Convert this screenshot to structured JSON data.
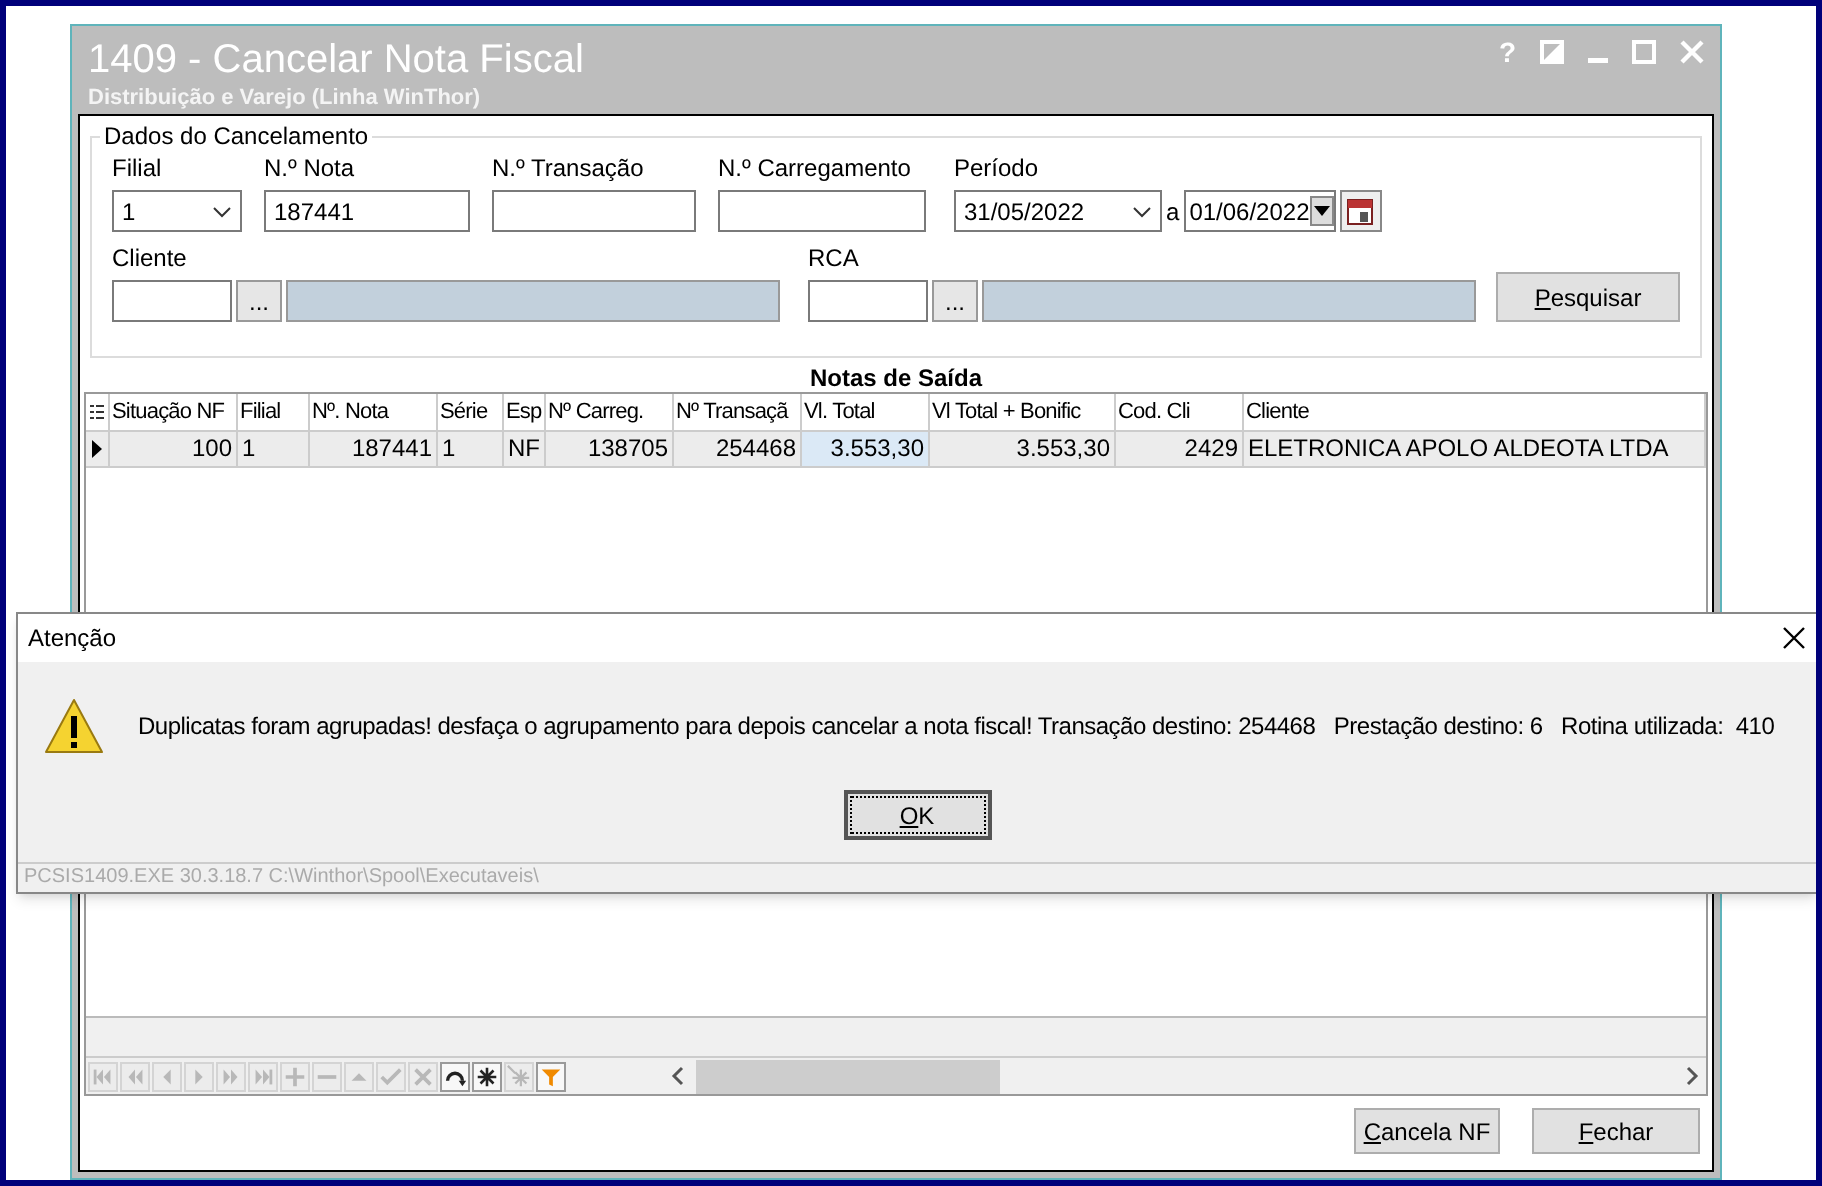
{
  "window": {
    "title": "1409 - Cancelar Nota Fiscal",
    "subtitle": "Distribuição e Varejo (Linha WinThor)",
    "controls": [
      "?"
    ]
  },
  "filter_group": {
    "title": "Dados do Cancelamento",
    "filial": {
      "label": "Filial",
      "value": "1"
    },
    "nota": {
      "label": "N.º Nota",
      "value": "187441"
    },
    "transacao": {
      "label": "N.º Transação"
    },
    "carregamento": {
      "label": "N.º Carregamento"
    },
    "periodo": {
      "label": "Período",
      "from": "31/05/2022",
      "separator": "a",
      "to": "01/06/2022"
    },
    "cliente": {
      "label": "Cliente",
      "lookup": "..."
    },
    "rca": {
      "label": "RCA",
      "lookup": "..."
    },
    "search_button": "Pesquisar"
  },
  "grid": {
    "title": "Notas de Saída",
    "columns": [
      {
        "label": "Situação NF",
        "kind": "number"
      },
      {
        "label": "Filial",
        "kind": "text"
      },
      {
        "label": "Nº. Nota",
        "kind": "number"
      },
      {
        "label": "Série",
        "kind": "text"
      },
      {
        "label": "Esp",
        "kind": "text"
      },
      {
        "label": "Nº Carreg.",
        "kind": "number"
      },
      {
        "label": "Nº Transaçã",
        "kind": "number"
      },
      {
        "label": "Vl. Total",
        "kind": "number"
      },
      {
        "label": "Vl Total + Bonific",
        "kind": "number"
      },
      {
        "label": "Cod. Cli",
        "kind": "number"
      },
      {
        "label": "Cliente",
        "kind": "text"
      }
    ],
    "rows": [
      {
        "selected": true,
        "cells": [
          {
            "text": "100",
            "focused": false
          },
          {
            "text": "1",
            "focused": false
          },
          {
            "text": "187441",
            "focused": false
          },
          {
            "text": "1",
            "focused": false
          },
          {
            "text": "NF",
            "focused": false
          },
          {
            "text": "138705",
            "focused": false
          },
          {
            "text": "254468",
            "focused": false
          },
          {
            "text": "3.553,30",
            "focused": true
          },
          {
            "text": "3.553,30",
            "focused": false
          },
          {
            "text": "2429",
            "focused": false
          },
          {
            "text": "ELETRONICA APOLO ALDEOTA LTDA",
            "focused": false
          }
        ]
      }
    ]
  },
  "navigator": [
    {
      "kind": "first",
      "disabled": true
    },
    {
      "kind": "prior-page",
      "disabled": true
    },
    {
      "kind": "prior",
      "disabled": true
    },
    {
      "kind": "next",
      "disabled": true
    },
    {
      "kind": "next-page",
      "disabled": true
    },
    {
      "kind": "last",
      "disabled": true
    },
    {
      "kind": "insert",
      "disabled": true
    },
    {
      "kind": "delete",
      "disabled": true
    },
    {
      "kind": "edit",
      "disabled": true
    },
    {
      "kind": "post",
      "disabled": true
    },
    {
      "kind": "cancel",
      "disabled": true
    },
    {
      "kind": "refresh",
      "disabled": false
    },
    {
      "kind": "bookmark",
      "disabled": false
    },
    {
      "kind": "goto-bookmark",
      "disabled": true
    },
    {
      "kind": "filter",
      "disabled": false
    }
  ],
  "buttons": [
    "Cancela NF",
    "Fechar"
  ],
  "dialog": {
    "title": "Atenção",
    "message": "Duplicatas foram agrupadas! desfaça o agrupamento para depois cancelar a nota fiscal! Transação destino: 254468   Prestação destino: 6   Rotina utilizada:  410",
    "ok": "OK",
    "footer": "PCSIS1409.EXE 30.3.18.7 C:\\Winthor\\Spool\\Executaveis\\"
  }
}
